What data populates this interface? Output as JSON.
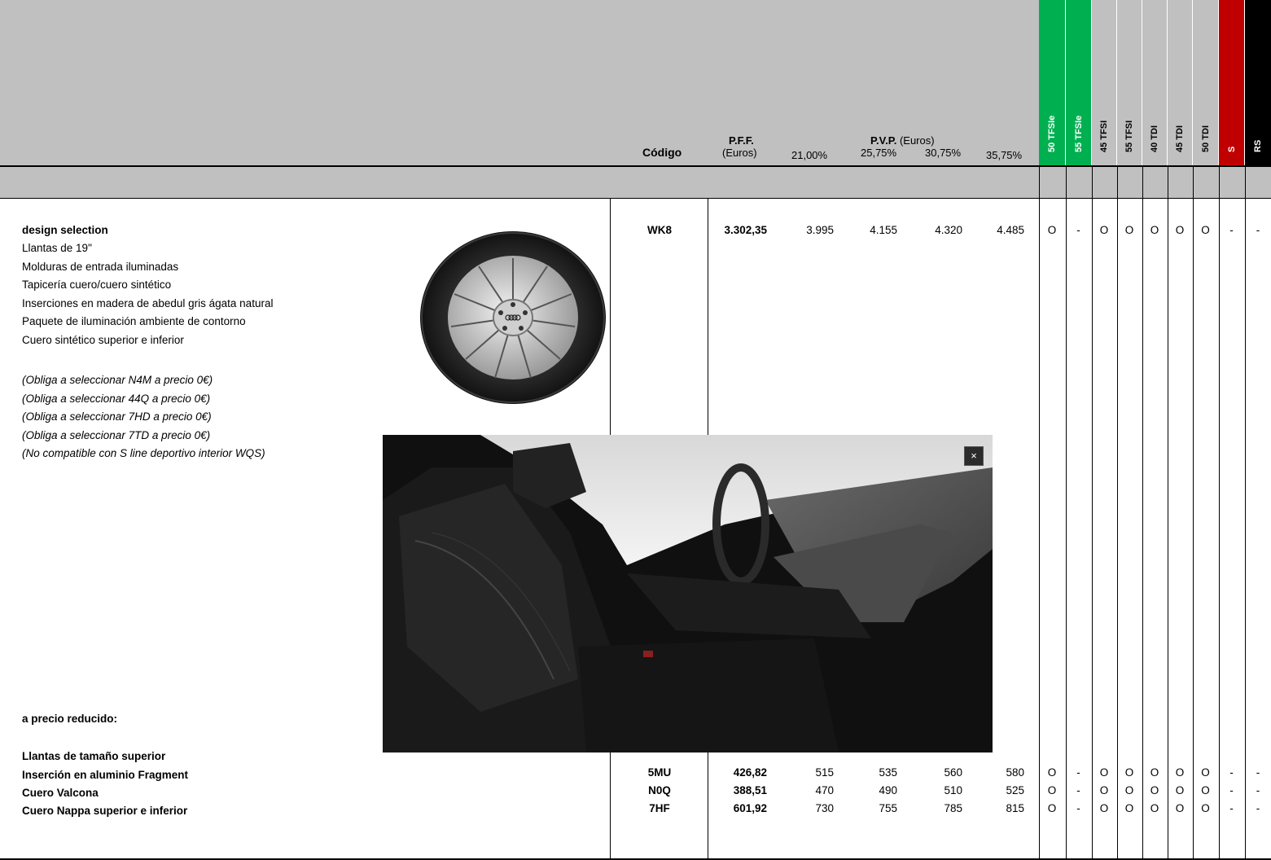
{
  "header": {
    "codigo": "Código",
    "pff": "P.F.F.",
    "pff_unit": "(Euros)",
    "pvp": "P.V.P.",
    "pvp_unit": "(Euros)",
    "rates": [
      "21,00%",
      "25,75%",
      "30,75%",
      "35,75%"
    ],
    "engines": [
      {
        "label": "50 TFSIe",
        "color": "#00b050",
        "text_color": "#ffffff"
      },
      {
        "label": "55 TFSIe",
        "color": "#00b050",
        "text_color": "#ffffff"
      },
      {
        "label": "45 TFSI",
        "color": "#c0c0c0",
        "text_color": "#000000"
      },
      {
        "label": "55 TFSI",
        "color": "#c0c0c0",
        "text_color": "#000000"
      },
      {
        "label": "40 TDI",
        "color": "#c0c0c0",
        "text_color": "#000000"
      },
      {
        "label": "45 TDI",
        "color": "#c0c0c0",
        "text_color": "#000000"
      },
      {
        "label": "50 TDI",
        "color": "#c0c0c0",
        "text_color": "#000000"
      },
      {
        "label": "S",
        "color": "#c00000",
        "text_color": "#ffffff"
      },
      {
        "label": "RS",
        "color": "#000000",
        "text_color": "#ffffff"
      }
    ]
  },
  "package": {
    "title": "design selection",
    "items": [
      "Llantas de 19\"",
      "Molduras de entrada iluminadas",
      "Tapicería cuero/cuero sintético",
      "Inserciones en madera de abedul gris ágata natural",
      "Paquete de iluminación ambiente de contorno",
      "Cuero sintético superior e inferior"
    ],
    "notes": [
      "(Obliga a seleccionar N4M a precio 0€)",
      "(Obliga a seleccionar 44Q a precio 0€)",
      "(Obliga a seleccionar 7HD a precio 0€)",
      "(Obliga a seleccionar 7TD a precio 0€)",
      "(No compatible con S line deportivo interior WQS)"
    ],
    "code": "WK8",
    "pff": "3.302,35",
    "prices": [
      "3.995",
      "4.155",
      "4.320",
      "4.485"
    ],
    "availability": [
      "O",
      "-",
      "O",
      "O",
      "O",
      "O",
      "O",
      "-",
      "-"
    ]
  },
  "reduced": {
    "title": "a precio reducido:",
    "subtitle": "Llantas de tamaño superior",
    "rows": [
      {
        "name": "Inserción en aluminio Fragment",
        "code": "5MU",
        "pff": "426,82",
        "prices": [
          "515",
          "535",
          "560",
          "580"
        ],
        "availability": [
          "O",
          "-",
          "O",
          "O",
          "O",
          "O",
          "O",
          "-",
          "-"
        ]
      },
      {
        "name": "Cuero Valcona",
        "code": "N0Q",
        "pff": "388,51",
        "prices": [
          "470",
          "490",
          "510",
          "525"
        ],
        "availability": [
          "O",
          "-",
          "O",
          "O",
          "O",
          "O",
          "O",
          "-",
          "-"
        ]
      },
      {
        "name": "Cuero Nappa superior e inferior",
        "code": "7HF",
        "pff": "601,92",
        "prices": [
          "730",
          "755",
          "785",
          "815"
        ],
        "availability": [
          "O",
          "-",
          "O",
          "O",
          "O",
          "O",
          "O",
          "-",
          "-"
        ]
      }
    ]
  },
  "overlay": {
    "close": "×"
  }
}
